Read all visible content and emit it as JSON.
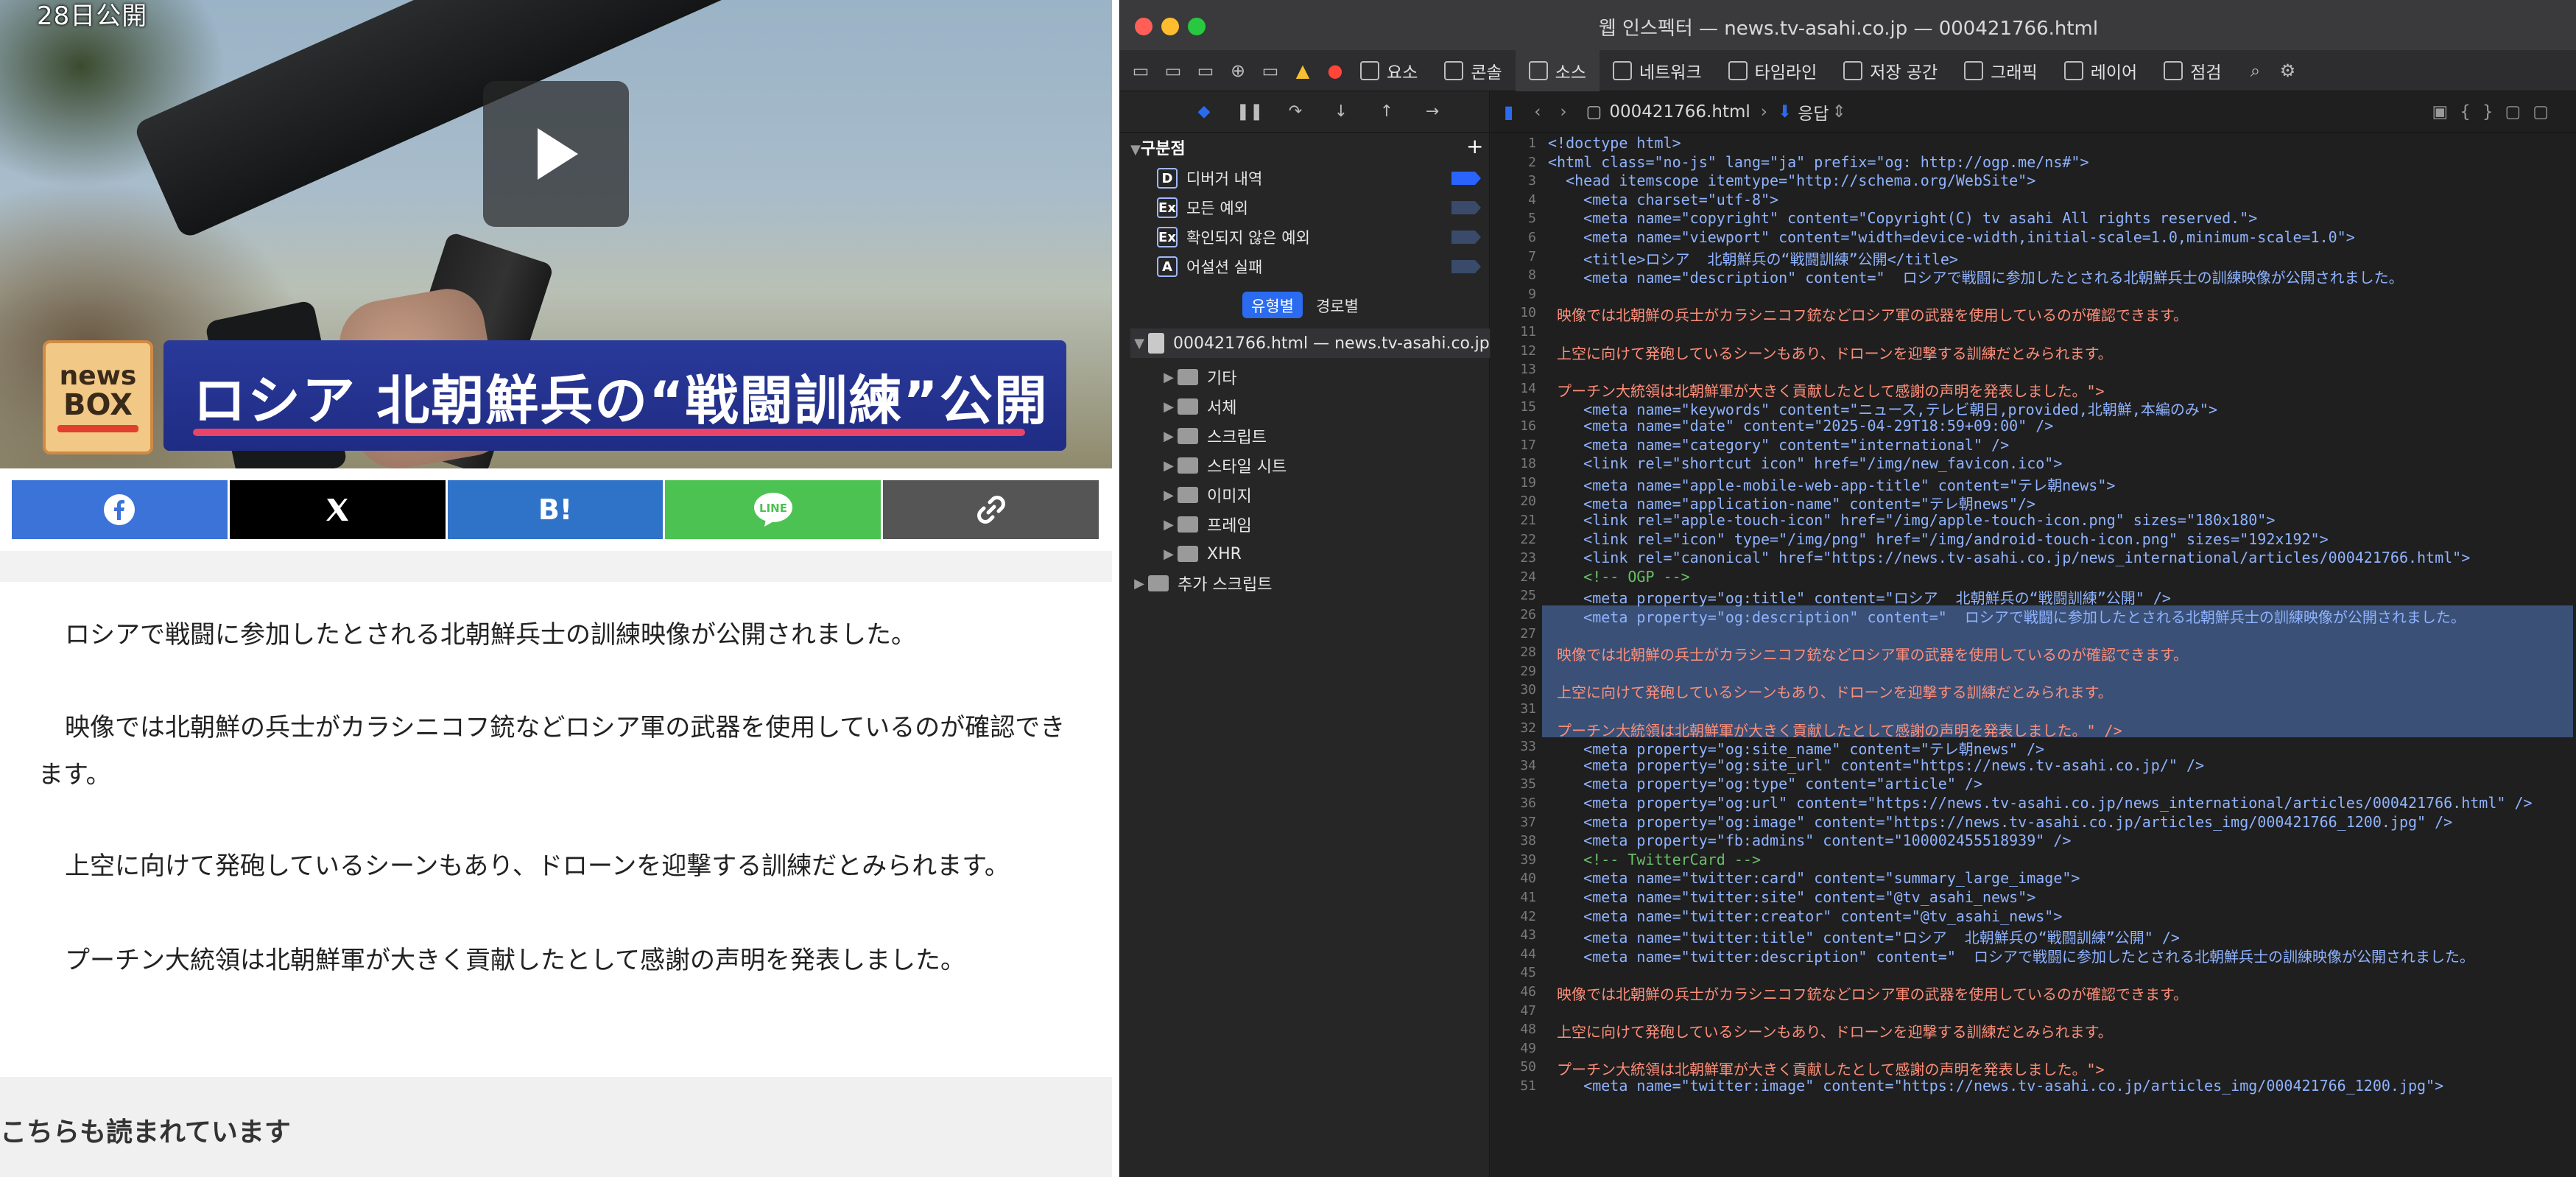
{
  "page": {
    "hero": {
      "timestamp": "28日公開",
      "headline": "ロシア 北朝鮮兵の“戦闘訓練”公開",
      "logo_top": "news",
      "logo_bottom": "BOX"
    },
    "share": {
      "hatena_label": "B!",
      "line_label": "LINE"
    },
    "article": {
      "paragraphs": [
        "ロシアで戦闘に参加したとされる北朝鮮兵士の訓練映像が公開されました。",
        "映像では北朝鮮の兵士がカラシニコフ銃などロシア軍の武器を使用しているのが確認できます。",
        "上空に向けて発砲しているシーンもあり、ドローンを迎撃する訓練だとみられます。",
        "プーチン大統領は北朝鮮軍が大きく貢献したとして感謝の声明を発表しました。"
      ],
      "related_title": "こちらも読まれています"
    }
  },
  "inspector": {
    "window_title": "웹 인스펙터 — news.tv-asahi.co.jp — 000421766.html",
    "tabs": [
      "요소",
      "콘솔",
      "소스",
      "네트워크",
      "타임라인",
      "저장 공간",
      "그래픽",
      "레이어",
      "점검"
    ],
    "active_tab": "소스",
    "sidebar": {
      "breakpoints_heading": "구분점",
      "breakpoints": [
        {
          "badge": "D",
          "label": "디버거 내역"
        },
        {
          "badge": "Ex",
          "label": "모든 예외"
        },
        {
          "badge": "Ex",
          "label": "확인되지 않은 예외"
        },
        {
          "badge": "A",
          "label": "어설션 실패"
        }
      ],
      "segments": [
        "유형별",
        "경로별"
      ],
      "resource_root": "000421766.html — news.tv-asahi.co.jp",
      "folders": [
        "기타",
        "서체",
        "스크립트",
        "스타일 시트",
        "이미지",
        "프레임",
        "XHR",
        "추가 스크립트"
      ]
    },
    "editor": {
      "file": "000421766.html",
      "mode": "응답",
      "lines": [
        {
          "n": "1",
          "t": "<!doctype html>"
        },
        {
          "n": "2",
          "t": "<html class=\"no-js\" lang=\"ja\" prefix=\"og: http://ogp.me/ns#\">"
        },
        {
          "n": "3",
          "t": "  <head itemscope itemtype=\"http://schema.org/WebSite\">"
        },
        {
          "n": "4",
          "t": "    <meta charset=\"utf-8\">"
        },
        {
          "n": "5",
          "t": "    <meta name=\"copyright\" content=\"Copyright(C) tv asahi All rights reserved.\">"
        },
        {
          "n": "6",
          "t": "    <meta name=\"viewport\" content=\"width=device-width,initial-scale=1.0,minimum-scale=1.0\">"
        },
        {
          "n": "7",
          "t": "    <title>ロシア  北朝鮮兵の“戦闘訓練”公開</title>"
        },
        {
          "n": "8",
          "t": "    <meta name=\"description\" content=\"  ロシアで戦闘に参加したとされる北朝鮮兵士の訓練映像が公開されました。"
        },
        {
          "n": "9",
          "t": ""
        },
        {
          "n": "10",
          "t": " 映像では北朝鮮の兵士がカラシニコフ銃などロシア軍の武器を使用しているのが確認できます。"
        },
        {
          "n": "11",
          "t": ""
        },
        {
          "n": "12",
          "t": " 上空に向けて発砲しているシーンもあり、ドローンを迎撃する訓練だとみられます。"
        },
        {
          "n": "13",
          "t": ""
        },
        {
          "n": "14",
          "t": " プーチン大統領は北朝鮮軍が大きく貢献したとして感謝の声明を発表しました。\">"
        },
        {
          "n": "15",
          "t": "    <meta name=\"keywords\" content=\"ニュース,テレビ朝日,provided,北朝鮮,本編のみ\">"
        },
        {
          "n": "16",
          "t": "    <meta name=\"date\" content=\"2025-04-29T18:59+09:00\" />"
        },
        {
          "n": "17",
          "t": "    <meta name=\"category\" content=\"international\" />"
        },
        {
          "n": "18",
          "t": "    <link rel=\"shortcut icon\" href=\"/img/new_favicon.ico\">"
        },
        {
          "n": "19",
          "t": "    <meta name=\"apple-mobile-web-app-title\" content=\"テレ朝news\">"
        },
        {
          "n": "20",
          "t": "    <meta name=\"application-name\" content=\"テレ朝news\"/>"
        },
        {
          "n": "21",
          "t": "    <link rel=\"apple-touch-icon\" href=\"/img/apple-touch-icon.png\" sizes=\"180x180\">"
        },
        {
          "n": "22",
          "t": "    <link rel=\"icon\" type=\"/img/png\" href=\"/img/android-touch-icon.png\" sizes=\"192x192\">"
        },
        {
          "n": "23",
          "t": "    <link rel=\"canonical\" href=\"https://news.tv-asahi.co.jp/news_international/articles/000421766.html\">"
        },
        {
          "n": "24",
          "t": "    <!-- OGP -->"
        },
        {
          "n": "25",
          "t": "    <meta property=\"og:title\" content=\"ロシア  北朝鮮兵の“戦闘訓練”公開\" />"
        },
        {
          "n": "26",
          "t": "    <meta property=\"og:description\" content=\"  ロシアで戦闘に参加したとされる北朝鮮兵士の訓練映像が公開されました。"
        },
        {
          "n": "27",
          "t": ""
        },
        {
          "n": "28",
          "t": " 映像では北朝鮮の兵士がカラシニコフ銃などロシア軍の武器を使用しているのが確認できます。"
        },
        {
          "n": "29",
          "t": ""
        },
        {
          "n": "30",
          "t": " 上空に向けて発砲しているシーンもあり、ドローンを迎撃する訓練だとみられます。"
        },
        {
          "n": "31",
          "t": ""
        },
        {
          "n": "32",
          "t": " プーチン大統領は北朝鮮軍が大きく貢献したとして感謝の声明を発表しました。\" />"
        },
        {
          "n": "33",
          "t": "    <meta property=\"og:site_name\" content=\"テレ朝news\" />"
        },
        {
          "n": "34",
          "t": "    <meta property=\"og:site_url\" content=\"https://news.tv-asahi.co.jp/\" />"
        },
        {
          "n": "35",
          "t": "    <meta property=\"og:type\" content=\"article\" />"
        },
        {
          "n": "36",
          "t": "    <meta property=\"og:url\" content=\"https://news.tv-asahi.co.jp/news_international/articles/000421766.html\" />"
        },
        {
          "n": "37",
          "t": "    <meta property=\"og:image\" content=\"https://news.tv-asahi.co.jp/articles_img/000421766_1200.jpg\" />"
        },
        {
          "n": "38",
          "t": "    <meta property=\"fb:admins\" content=\"100002455518939\" />"
        },
        {
          "n": "39",
          "t": "    <!-- TwitterCard -->"
        },
        {
          "n": "40",
          "t": "    <meta name=\"twitter:card\" content=\"summary_large_image\">"
        },
        {
          "n": "41",
          "t": "    <meta name=\"twitter:site\" content=\"@tv_asahi_news\">"
        },
        {
          "n": "42",
          "t": "    <meta name=\"twitter:creator\" content=\"@tv_asahi_news\">"
        },
        {
          "n": "43",
          "t": "    <meta name=\"twitter:title\" content=\"ロシア  北朝鮮兵の“戦闘訓練”公開\" />"
        },
        {
          "n": "44",
          "t": "    <meta name=\"twitter:description\" content=\"  ロシアで戦闘に参加したとされる北朝鮮兵士の訓練映像が公開されました。"
        },
        {
          "n": "45",
          "t": ""
        },
        {
          "n": "46",
          "t": " 映像では北朝鮮の兵士がカラシニコフ銃などロシア軍の武器を使用しているのが確認できます。"
        },
        {
          "n": "47",
          "t": ""
        },
        {
          "n": "48",
          "t": " 上空に向けて発砲しているシーンもあり、ドローンを迎撃する訓練だとみられます。"
        },
        {
          "n": "49",
          "t": ""
        },
        {
          "n": "50",
          "t": " プーチン大統領は北朝鮮軍が大きく貢献したとして感謝の声明を発表しました。\">"
        },
        {
          "n": "51",
          "t": "    <meta name=\"twitter:image\" content=\"https://news.tv-asahi.co.jp/articles_img/000421766_1200.jpg\">"
        }
      ]
    }
  }
}
